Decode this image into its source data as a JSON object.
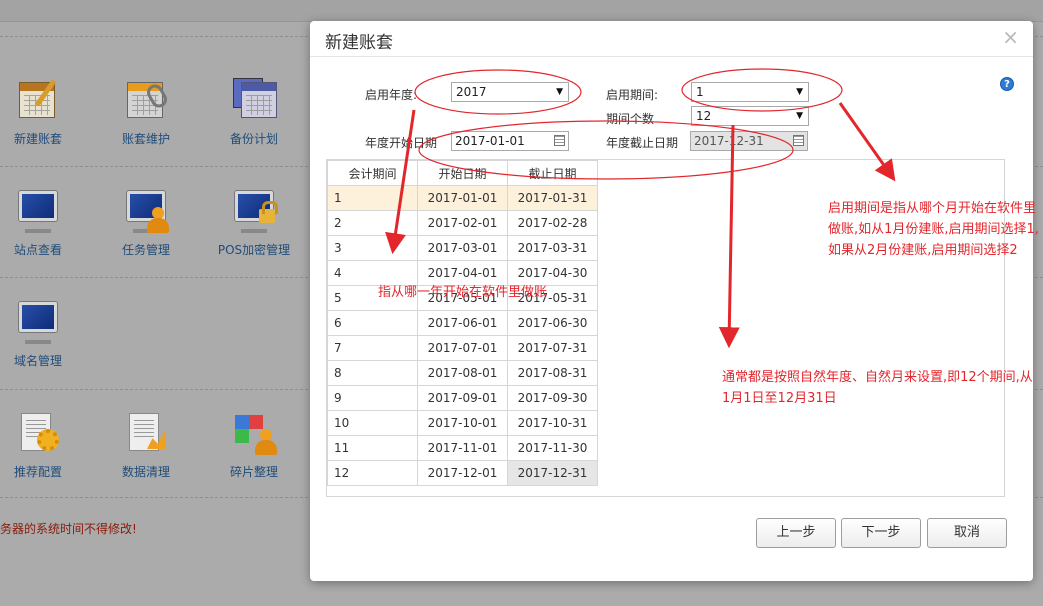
{
  "background": {
    "tiles": [
      {
        "label": "新建账套",
        "icon": "new-book-icon"
      },
      {
        "label": "账套维护",
        "icon": "book-maintain-icon"
      },
      {
        "label": "备份计划",
        "icon": "backup-plan-icon"
      },
      {
        "label": "站点查看",
        "icon": "monitor-icon"
      },
      {
        "label": "任务管理",
        "icon": "task-monitor-icon"
      },
      {
        "label": "POS加密管理",
        "icon": "pos-lock-icon"
      },
      {
        "label": "域名管理",
        "icon": "domain-monitor-icon"
      },
      {
        "label": "推荐配置",
        "icon": "config-gear-icon"
      },
      {
        "label": "数据清理",
        "icon": "data-clean-icon"
      },
      {
        "label": "碎片整理",
        "icon": "defrag-icon"
      }
    ],
    "note": "务器的系统时间不得修改!"
  },
  "dialog": {
    "title": "新建账套",
    "close_glyph": "×",
    "help_glyph": "?",
    "fields": {
      "start_year_label": "启用年度:",
      "start_year_value": "2017",
      "start_period_label": "启用期间:",
      "start_period_value": "1",
      "period_count_label": "期间个数",
      "period_count_value": "12",
      "year_start_label": "年度开始日期",
      "year_start_value": "2017-01-01",
      "year_end_label": "年度截止日期",
      "year_end_value": "2017-12-31"
    },
    "table": {
      "headers": [
        "会计期间",
        "开始日期",
        "截止日期"
      ],
      "rows": [
        [
          "1",
          "2017-01-01",
          "2017-01-31"
        ],
        [
          "2",
          "2017-02-01",
          "2017-02-28"
        ],
        [
          "3",
          "2017-03-01",
          "2017-03-31"
        ],
        [
          "4",
          "2017-04-01",
          "2017-04-30"
        ],
        [
          "5",
          "2017-05-01",
          "2017-05-31"
        ],
        [
          "6",
          "2017-06-01",
          "2017-06-30"
        ],
        [
          "7",
          "2017-07-01",
          "2017-07-31"
        ],
        [
          "8",
          "2017-08-01",
          "2017-08-31"
        ],
        [
          "9",
          "2017-09-01",
          "2017-09-30"
        ],
        [
          "10",
          "2017-10-01",
          "2017-10-31"
        ],
        [
          "11",
          "2017-11-01",
          "2017-11-30"
        ],
        [
          "12",
          "2017-12-01",
          "2017-12-31"
        ]
      ]
    },
    "buttons": {
      "prev": "上一步",
      "next": "下一步",
      "cancel": "取消"
    }
  },
  "annotations": {
    "year_note": "指从哪一年开始在软件里做账",
    "period_note": "启用期间是指从哪个月开始在软件里做账,如从1月份建账,启用期间选择1,如果从2月份建账,启用期间选择2",
    "natural_note": "通常都是按照自然年度、自然月来设置,即12个期间,从1月1日至12月31日",
    "color": "#e3262c"
  },
  "colors": {
    "overlay_bg": "#ababab",
    "highlight_row": "#fdf1dc",
    "help_icon": "#2e7bd6"
  }
}
